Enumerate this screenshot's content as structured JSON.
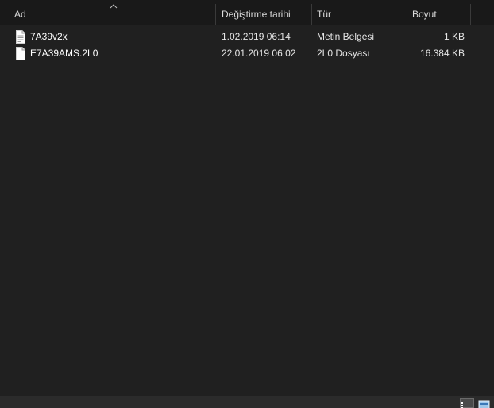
{
  "columns": {
    "name": "Ad",
    "date": "Değiştirme tarihi",
    "type": "Tür",
    "size": "Boyut"
  },
  "files": [
    {
      "name": "7A39v2x",
      "date": "1.02.2019 06:14",
      "type": "Metin Belgesi",
      "size": "1 KB",
      "icon": "text-file-icon"
    },
    {
      "name": "E7A39AMS.2L0",
      "date": "22.01.2019 06:02",
      "type": "2L0 Dosyası",
      "size": "16.384 KB",
      "icon": "generic-file-icon"
    }
  ],
  "colors": {
    "background": "#202020",
    "header_background": "#191919",
    "text": "#ffffff",
    "status_bar": "#2b2b2b"
  }
}
